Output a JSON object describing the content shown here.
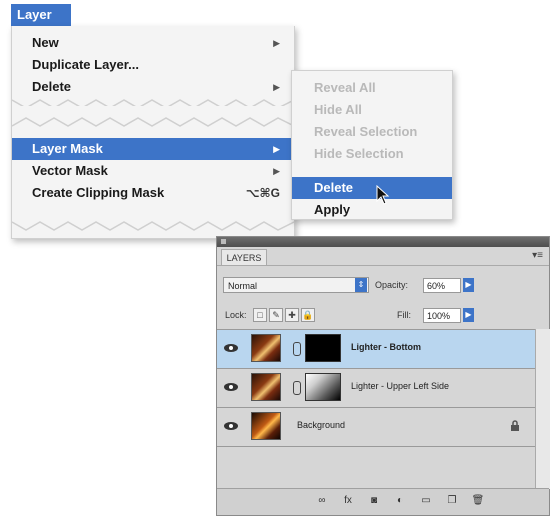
{
  "menu": {
    "title": "Layer",
    "items": [
      {
        "label": "New",
        "submenu": true
      },
      {
        "label": "Duplicate Layer...",
        "submenu": false
      },
      {
        "label": "Delete",
        "submenu": true
      },
      {
        "label": "Layer Mask",
        "submenu": true,
        "highlighted": true
      },
      {
        "label": "Vector Mask",
        "submenu": true
      },
      {
        "label": "Create Clipping Mask",
        "shortcut": "⌥⌘G"
      }
    ]
  },
  "submenu": {
    "items": [
      {
        "label": "Reveal All",
        "enabled": false
      },
      {
        "label": "Hide All",
        "enabled": false
      },
      {
        "label": "Reveal Selection",
        "enabled": false
      },
      {
        "label": "Hide Selection",
        "enabled": false
      },
      {
        "label": "Delete",
        "enabled": true,
        "highlighted": true
      },
      {
        "label": "Apply",
        "enabled": true
      }
    ]
  },
  "panel": {
    "tab": "LAYERS",
    "blend_mode": "Normal",
    "opacity_label": "Opacity:",
    "opacity_value": "60%",
    "lock_label": "Lock:",
    "fill_label": "Fill:",
    "fill_value": "100%",
    "layers": [
      {
        "name": "Lighter - Bottom",
        "selected": true,
        "mask": "black"
      },
      {
        "name": "Lighter - Upper Left Side",
        "selected": false,
        "mask": "gradient"
      },
      {
        "name": "Background",
        "selected": false,
        "locked": true
      }
    ]
  },
  "colors": {
    "highlight": "#3d74c8",
    "selected_layer": "#b9d6ef",
    "menu_bg": "#f4f4f4"
  }
}
